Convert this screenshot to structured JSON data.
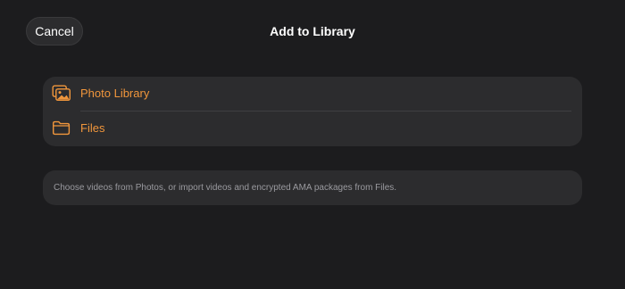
{
  "header": {
    "cancel_label": "Cancel",
    "title": "Add to Library"
  },
  "options": [
    {
      "label": "Photo Library",
      "icon": "photo-library-icon"
    },
    {
      "label": "Files",
      "icon": "folder-icon"
    }
  ],
  "info": {
    "text": "Choose videos from Photos, or import videos and encrypted AMA packages from Files."
  },
  "colors": {
    "background": "#1c1c1e",
    "card": "#2c2c2e",
    "accent": "#f0963c",
    "secondary_text": "#9a9a9f"
  }
}
